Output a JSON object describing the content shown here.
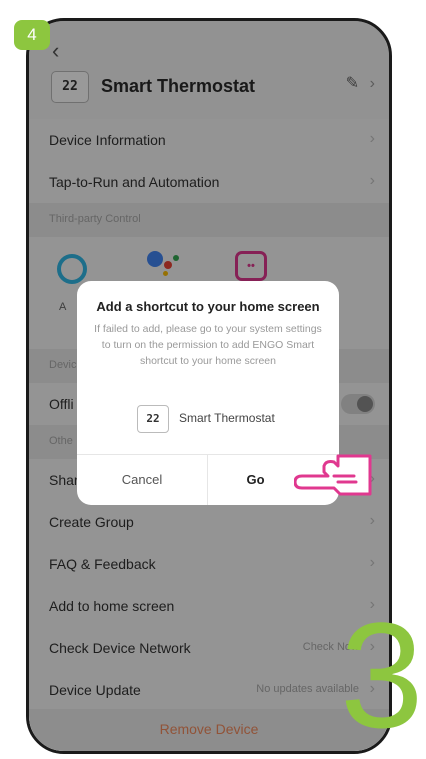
{
  "step_badge": "4",
  "header": {
    "title": "Smart Thermostat",
    "icon_text": "22"
  },
  "menu": {
    "device_information": "Device Information",
    "tap_to_run": "Tap-to-Run and Automation",
    "third_party_section": "Third-party Control",
    "alexa_label_partial": "A",
    "device_section_partial": "Devic",
    "offline_label_partial": "Offli",
    "others_section_partial": "Othe",
    "share_label_partial": "Shar",
    "create_group": "Create Group",
    "faq_feedback": "FAQ & Feedback",
    "add_home_screen": "Add to home screen",
    "check_network": "Check Device Network",
    "check_network_value": "Check Now",
    "device_update": "Device Update",
    "device_update_value": "No updates available",
    "remove_device": "Remove Device"
  },
  "dialog": {
    "title": "Add a shortcut to your home screen",
    "message": "If failed to add, please go to your system settings to turn on the permission to add ENGO Smart shortcut to your home screen",
    "device_name": "Smart Thermostat",
    "device_icon_text": "22",
    "cancel": "Cancel",
    "go": "Go"
  },
  "step_number": "3",
  "colors": {
    "accent_green": "#8dc63f",
    "highlight_pink": "#e0388f",
    "remove_orange": "#f28b5e"
  }
}
